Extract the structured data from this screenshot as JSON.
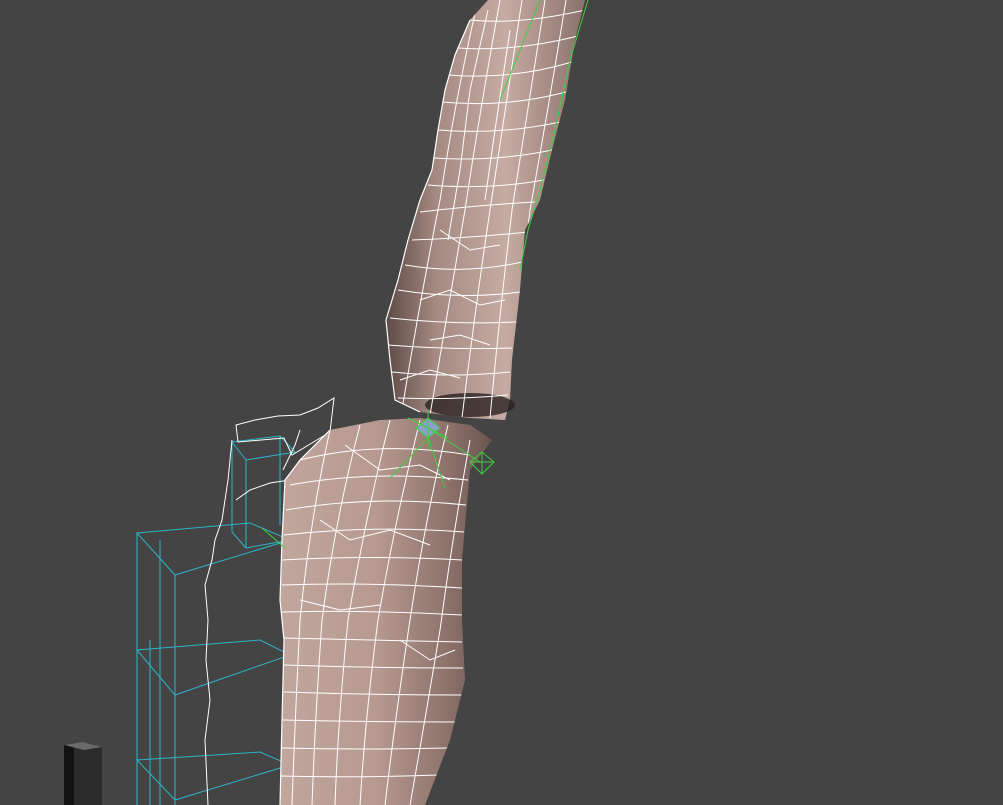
{
  "viewport": {
    "background": "#444444",
    "mesh_skin_color": "#a88c84",
    "wireframe_color": "#ffffff",
    "joint_color": "#3fcf3f",
    "bounding_box_color": "#2fb3c7",
    "selected_vertex_color": "#8aa0c8"
  },
  "objects": [
    {
      "name": "upper-arm-mesh",
      "kind": "polygon mesh with wireframe overlay"
    },
    {
      "name": "forearm-mesh",
      "kind": "polygon mesh with wireframe overlay"
    },
    {
      "name": "elbow-joint",
      "kind": "skeleton joint"
    },
    {
      "name": "wrist-joint",
      "kind": "skeleton joint"
    },
    {
      "name": "cloth-flap",
      "kind": "wireframe plane"
    },
    {
      "name": "locator-cubes",
      "kind": "wireframe boxes"
    },
    {
      "name": "dark-post",
      "kind": "shaded box"
    }
  ]
}
